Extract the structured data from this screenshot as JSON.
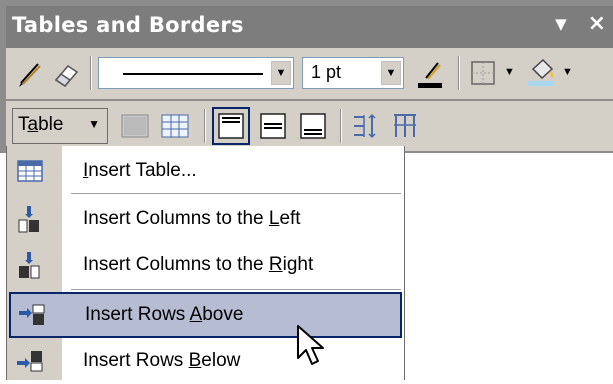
{
  "window": {
    "title": "Tables and Borders"
  },
  "toolbar1": {
    "draw_table_icon": "pencil-icon",
    "eraser_icon": "eraser-icon",
    "line_style_value": "",
    "line_weight_value": "1 pt",
    "border_color_icon": "pen-color-icon",
    "border_icon": "outside-border-icon",
    "shading_icon": "paint-bucket-icon"
  },
  "toolbar2": {
    "table_menu": {
      "pre": "T",
      "ul": "a",
      "post": "ble"
    }
  },
  "menu": {
    "items": [
      {
        "icon": "insert-table-icon",
        "pre": "",
        "ul": "I",
        "post": "nsert Table..."
      },
      {
        "icon": "insert-columns-left-icon",
        "pre": "Insert Columns to the ",
        "ul": "L",
        "post": "eft"
      },
      {
        "icon": "insert-columns-right-icon",
        "pre": "Insert Columns to the ",
        "ul": "R",
        "post": "ight"
      },
      {
        "icon": "insert-rows-above-icon",
        "pre": "Insert Rows ",
        "ul": "A",
        "post": "bove"
      },
      {
        "icon": "insert-rows-below-icon",
        "pre": "Insert Rows ",
        "ul": "B",
        "post": "elow"
      }
    ],
    "highlighted_item": "Insert Rows Above"
  },
  "colors": {
    "titlebar": "#7d7d7d",
    "toolbar": "#d4d0c8",
    "menu_highlight": "#b6bdd2",
    "highlight_border": "#0a246a"
  }
}
